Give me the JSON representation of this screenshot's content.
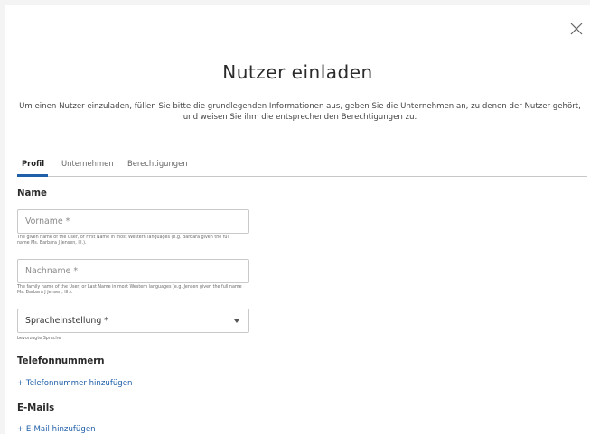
{
  "dialog": {
    "title": "Nutzer einladen",
    "description": "Um einen Nutzer einzuladen, füllen Sie bitte die grundlegenden Informationen aus, geben Sie die Unternehmen an, zu denen der Nutzer gehört, und weisen Sie ihm die entsprechenden Berechtigungen zu."
  },
  "tabs": [
    {
      "label": "Profil",
      "active": true
    },
    {
      "label": "Unternehmen",
      "active": false
    },
    {
      "label": "Berechtigungen",
      "active": false
    }
  ],
  "sections": {
    "name": {
      "heading": "Name",
      "first_name": {
        "placeholder": "Vorname *",
        "value": "",
        "help": "The given name of the User, or First Name in most Western languages (e.g. Barbara given the full name Ms. Barbara J Jensen, III.)."
      },
      "last_name": {
        "placeholder": "Nachname *",
        "value": "",
        "help": "The family name of the User, or Last Name in most Western languages (e.g. Jensen given the full name Ms. Barbara J Jensen, III.)."
      },
      "language": {
        "label": "Spracheinstellung *",
        "help": "bevorzugte Sprache"
      }
    },
    "phones": {
      "heading": "Telefonnummern",
      "add_link": "+ Telefonnummer hinzufügen"
    },
    "emails": {
      "heading": "E-Mails",
      "add_link": "+ E-Mail hinzufügen"
    }
  },
  "colors": {
    "accent": "#1f5ea8",
    "border": "#c9c9c9",
    "background": "#ffffff"
  },
  "icons": {
    "close": "close-icon",
    "dropdown": "chevron-down-icon"
  }
}
